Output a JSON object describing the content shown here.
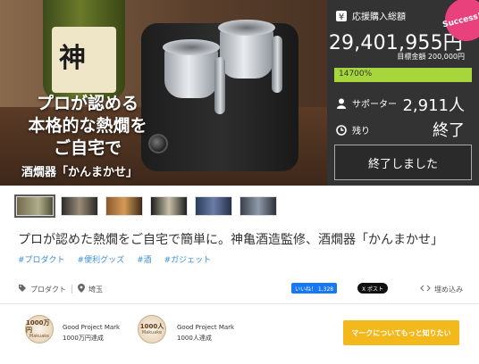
{
  "hero": {
    "title_lines": [
      "プロが認める",
      "本格的な熱燗を",
      "ご自宅で"
    ],
    "subtitle": "酒燗器「かんまかせ」",
    "bottle_glyph": "神"
  },
  "stats": {
    "total_label": "応援購入総額",
    "total_amount": "29,401,955円",
    "goal_text": "目標金額 200,000円",
    "progress_percent": 14700,
    "progress_text": "14700%",
    "supporters_label": "サポーター",
    "supporters_value": "2,911人",
    "remaining_label": "残り",
    "remaining_value": "終了",
    "status_button": "終了しました",
    "success_badge": "Success!"
  },
  "thumbnails_count": 6,
  "project": {
    "title": "プロが認めた熱燗をご自宅で簡単に。神亀酒造監修、酒燗器「かんまかせ」",
    "tags": [
      "#プロダクト",
      "#便利グッズ",
      "#酒",
      "#ガジェット"
    ]
  },
  "meta": {
    "category": "プロダクト",
    "location": "埼玉",
    "fb_label": "いいね！ 1,328",
    "x_label": "X ポスト",
    "embed_label": "埋め込み"
  },
  "marks": [
    {
      "badge_num": "1000万円",
      "badge_sub": "Makuake",
      "title": "Good Project Mark",
      "desc": "1000万円達成"
    },
    {
      "badge_num": "1000人",
      "badge_sub": "Makuake",
      "title": "Good Project Mark",
      "desc": "1000人達成"
    }
  ],
  "cta_label": "マークについてもっと知りたい",
  "colors": {
    "progress_fill": "#a6d63b",
    "stats_bg": "#333333",
    "badge": "#e8417c",
    "tag_link": "#3b8fd6",
    "cta": "#f2b81c"
  }
}
